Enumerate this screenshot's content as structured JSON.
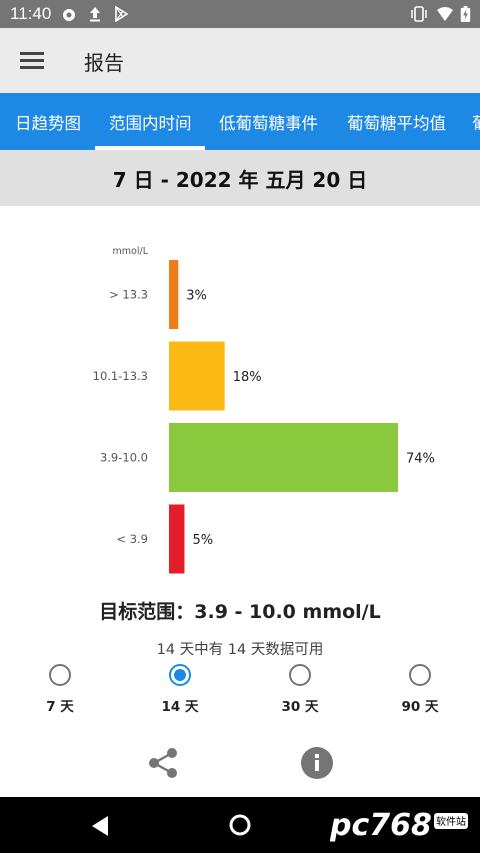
{
  "status_bar": {
    "time": "11:40",
    "left_icons": [
      "notification-circle-icon",
      "upload-icon",
      "play-store-icon"
    ],
    "right_icons": [
      "vibrate-icon",
      "wifi-icon",
      "battery-charging-icon"
    ]
  },
  "app_bar": {
    "menu_icon": "hamburger-menu-icon",
    "title": "报告"
  },
  "tabs": [
    {
      "label": "日趋势图",
      "active": false
    },
    {
      "label": "范围内时间",
      "active": true
    },
    {
      "label": "低葡萄糖事件",
      "active": false
    },
    {
      "label": "葡萄糖平均值",
      "active": false
    },
    {
      "label": "葡",
      "active": false
    }
  ],
  "date_range": "7 日 - 2022 年 五月 20 日",
  "chart_data": {
    "type": "bar",
    "orientation": "horizontal",
    "unit_label": "mmol/L",
    "categories": [
      "> 13.3",
      "10.1-13.3",
      "3.9-10.0",
      "< 3.9"
    ],
    "values": [
      3,
      18,
      74,
      5
    ],
    "value_labels": [
      "3%",
      "18%",
      "74%",
      "5%"
    ],
    "colors": [
      "#f07d19",
      "#fdb913",
      "#8ac83e",
      "#e51d2a"
    ],
    "axis_max": 74
  },
  "target_range": "目标范围：3.9 - 10.0 mmol/L",
  "days_available": "14 天中有 14 天数据可用",
  "periods": [
    {
      "label": "7 天",
      "selected": false
    },
    {
      "label": "14 天",
      "selected": true
    },
    {
      "label": "30 天",
      "selected": false
    },
    {
      "label": "90 天",
      "selected": false
    }
  ],
  "actions": {
    "share_icon": "share-icon",
    "info_icon": "info-icon"
  },
  "nav_bar": {
    "icons": [
      "back-icon",
      "home-icon"
    ]
  },
  "watermark": {
    "text": "pc768",
    "badge": "软件站"
  },
  "colors": {
    "tab_bar": "#1e88e5",
    "accent": "#1e88e5",
    "date_band": "#e0e0e0",
    "app_bar": "#ebebeb",
    "status_bar": "#757575"
  }
}
